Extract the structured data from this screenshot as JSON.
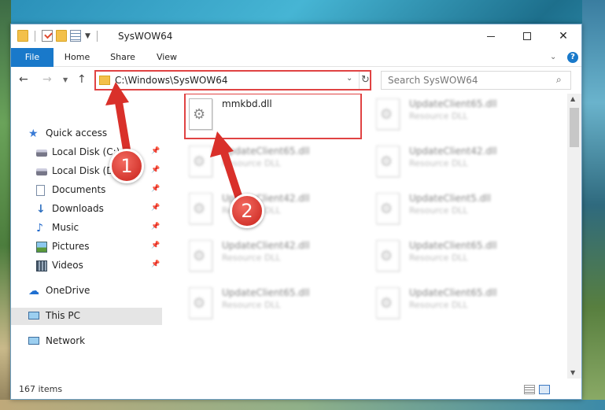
{
  "window": {
    "title": "SysWOW64",
    "controls": {
      "minimize": "minimize",
      "maximize": "maximize",
      "close": "✕"
    }
  },
  "ribbon": {
    "tabs": [
      {
        "label": "File"
      },
      {
        "label": "Home"
      },
      {
        "label": "Share"
      },
      {
        "label": "View"
      }
    ],
    "help": "?"
  },
  "navbar": {
    "address": "C:\\Windows\\SysWOW64",
    "search_placeholder": "Search SysWOW64"
  },
  "nav_pane": {
    "quick_access": "Quick access",
    "items": [
      {
        "label": "Local Disk (C:)"
      },
      {
        "label": "Local Disk (D:)"
      },
      {
        "label": "Documents"
      },
      {
        "label": "Downloads"
      },
      {
        "label": "Music"
      },
      {
        "label": "Pictures"
      },
      {
        "label": "Videos"
      }
    ],
    "onedrive": "OneDrive",
    "this_pc": "This PC",
    "network": "Network"
  },
  "files": {
    "highlighted": {
      "name": "mmkbd.dll"
    },
    "blurred": [
      {
        "name": "UpdateClient65.dll",
        "desc": "Resource DLL"
      },
      {
        "name": "UpdateClient65.dll",
        "desc": "Resource DLL"
      },
      {
        "name": "UpdateClient42.dll",
        "desc": "Resource DLL"
      },
      {
        "name": "UpdateClient42.dll",
        "desc": "Resource DLL"
      },
      {
        "name": "UpdateClient5.dll",
        "desc": "Resource DLL"
      },
      {
        "name": "UpdateClient42.dll",
        "desc": "Resource DLL"
      },
      {
        "name": "UpdateClient65.dll",
        "desc": "Resource DLL"
      },
      {
        "name": "UpdateClient65.dll",
        "desc": "Resource DLL"
      },
      {
        "name": "UpdateClient65.dll",
        "desc": "Resource DLL"
      }
    ]
  },
  "status": {
    "item_count": "167 items"
  },
  "annotations": {
    "step1": "1",
    "step2": "2",
    "color": "#e04343"
  }
}
